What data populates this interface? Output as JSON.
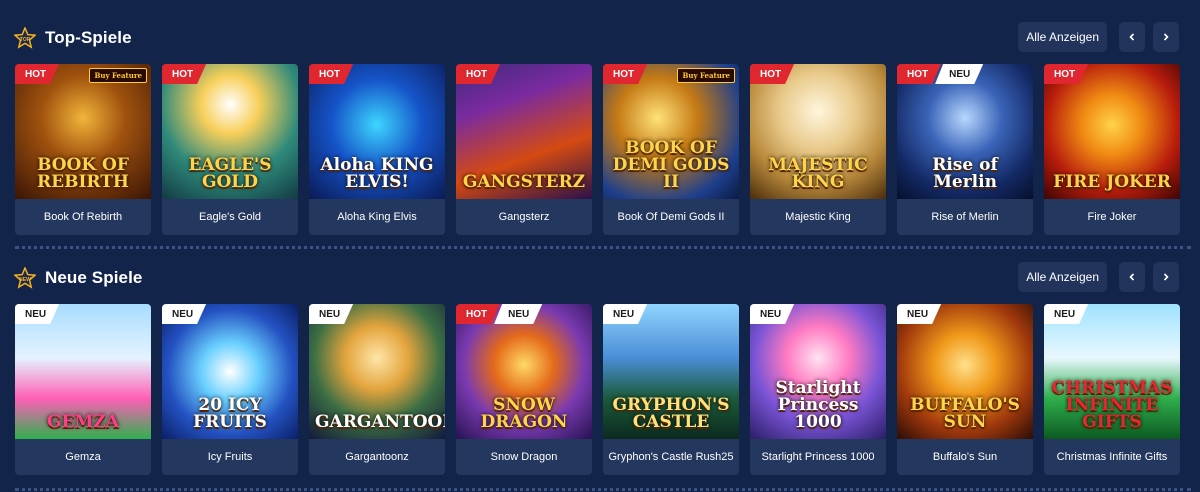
{
  "sections": [
    {
      "title": "Top-Spiele",
      "icon": "top-star-icon",
      "icon_text": "TOP",
      "view_all": "Alle Anzeigen",
      "games": [
        {
          "name": "Book Of Rebirth",
          "logo": "BOOK OF REBIRTH",
          "badges": [
            "HOT"
          ],
          "buy_feature": "Buy Feature",
          "bg": "book"
        },
        {
          "name": "Eagle's Gold",
          "logo": "EAGLE'S GOLD",
          "badges": [
            "HOT"
          ],
          "buy_feature": "",
          "bg": "eagle"
        },
        {
          "name": "Aloha King Elvis",
          "logo": "Aloha KING ELVIS!",
          "badges": [
            "HOT"
          ],
          "buy_feature": "",
          "bg": "aloha"
        },
        {
          "name": "Gangsterz",
          "logo": "GANGSTERZ",
          "badges": [
            "HOT"
          ],
          "buy_feature": "",
          "bg": "gang"
        },
        {
          "name": "Book Of Demi Gods II",
          "logo": "BOOK OF DEMI GODS II",
          "badges": [
            "HOT"
          ],
          "buy_feature": "Buy Feature",
          "bg": "demi"
        },
        {
          "name": "Majestic King",
          "logo": "MAJESTIC KING",
          "badges": [
            "HOT"
          ],
          "buy_feature": "",
          "bg": "lion"
        },
        {
          "name": "Rise of Merlin",
          "logo": "Rise of Merlin",
          "badges": [
            "HOT",
            "NEU"
          ],
          "buy_feature": "",
          "bg": "merlin"
        },
        {
          "name": "Fire Joker",
          "logo": "FIRE JOKER",
          "badges": [
            "HOT"
          ],
          "buy_feature": "",
          "bg": "joker"
        }
      ]
    },
    {
      "title": "Neue Spiele",
      "icon": "new-star-icon",
      "icon_text": "NEW",
      "view_all": "Alle Anzeigen",
      "games": [
        {
          "name": "Gemza",
          "logo": "GEMZA",
          "badges": [
            "NEU"
          ],
          "buy_feature": "",
          "bg": "gemza"
        },
        {
          "name": "Icy Fruits",
          "logo": "20 ICY FRUITS",
          "badges": [
            "NEU"
          ],
          "buy_feature": "",
          "bg": "icy"
        },
        {
          "name": "Gargantoonz",
          "logo": "GARGANTOONZ",
          "badges": [
            "NEU"
          ],
          "buy_feature": "",
          "bg": "garg"
        },
        {
          "name": "Snow Dragon",
          "logo": "SNOW DRAGON",
          "badges": [
            "HOT",
            "NEU"
          ],
          "buy_feature": "",
          "bg": "dragon"
        },
        {
          "name": "Gryphon's Castle Rush25",
          "logo": "GRYPHON'S CASTLE",
          "badges": [
            "NEU"
          ],
          "buy_feature": "",
          "bg": "gryphon"
        },
        {
          "name": "Starlight Princess 1000",
          "logo": "Starlight Princess 1000",
          "badges": [
            "NEU"
          ],
          "buy_feature": "",
          "bg": "star"
        },
        {
          "name": "Buffalo's Sun",
          "logo": "BUFFALO'S SUN",
          "badges": [
            "NEU"
          ],
          "buy_feature": "",
          "bg": "buffalo"
        },
        {
          "name": "Christmas Infinite Gifts",
          "logo": "CHRISTMAS INFINITE GIFTS",
          "badges": [
            "NEU"
          ],
          "buy_feature": "",
          "bg": "xmas"
        }
      ]
    }
  ],
  "colors": {
    "page_bg": "#13244a",
    "card_bg": "#24375f",
    "button_bg": "#22345c",
    "hot_badge": "#e0262f",
    "neu_badge": "#ffffff",
    "accent_gold": "#f5b21a"
  }
}
